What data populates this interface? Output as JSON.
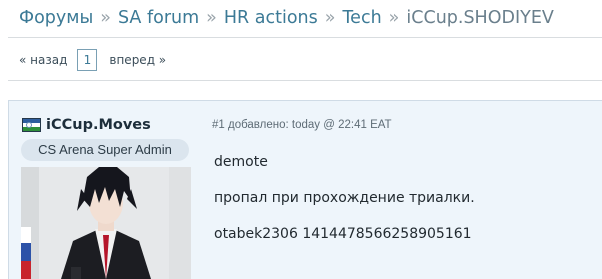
{
  "breadcrumb": {
    "items": [
      "Форумы",
      "SA forum",
      "HR actions",
      "Tech"
    ],
    "current": "iCCup.SHODIYEV",
    "separator": "»"
  },
  "pagination": {
    "prev": "« назад",
    "page": "1",
    "next": "вперед »"
  },
  "post": {
    "author": "iCCup.Moves",
    "role": "CS Arena Super Admin",
    "meta": "#1 добавлено: today @ 22:41 EAT",
    "lines": [
      "demote",
      "пропал при прохождение триалки.",
      "otabek2306 1414478566258905161"
    ],
    "flag_icon": "uzbekistan-flag-icon"
  }
}
